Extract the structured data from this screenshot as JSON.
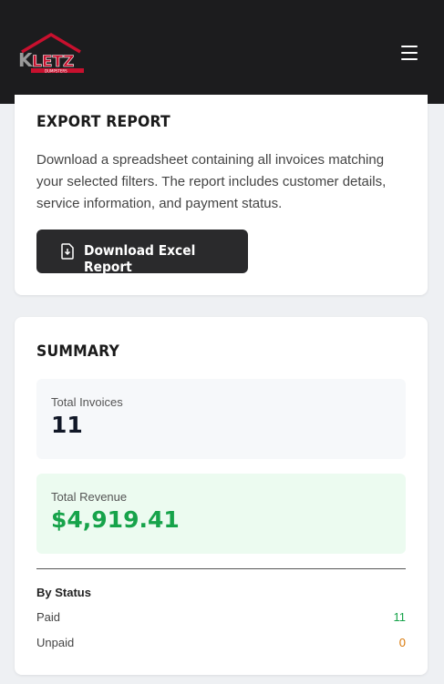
{
  "header": {
    "logo_text": "KLETZ",
    "logo_subtext": "DUMPSTERS",
    "menu_icon": "hamburger-menu-icon"
  },
  "export_report": {
    "title": "EXPORT REPORT",
    "description": "Download a spreadsheet containing all invoices matching your selected filters. The report includes customer details, service information, and payment status.",
    "download_button_label": "Download Excel Report",
    "download_icon": "file-download-icon"
  },
  "summary": {
    "title": "SUMMARY",
    "total_invoices_label": "Total Invoices",
    "total_invoices_value": "11",
    "total_revenue_label": "Total Revenue",
    "total_revenue_value": "$4,919.41",
    "by_status_label": "By Status",
    "statuses": [
      {
        "label": "Paid",
        "count": "11",
        "color": "#16a34a"
      },
      {
        "label": "Unpaid",
        "count": "0",
        "color": "#d97706"
      }
    ]
  },
  "colors": {
    "header_bg": "#1c1c1e",
    "brand_red": "#c8102e",
    "button_bg": "#2a2a2c",
    "revenue_green": "#16a34a"
  }
}
